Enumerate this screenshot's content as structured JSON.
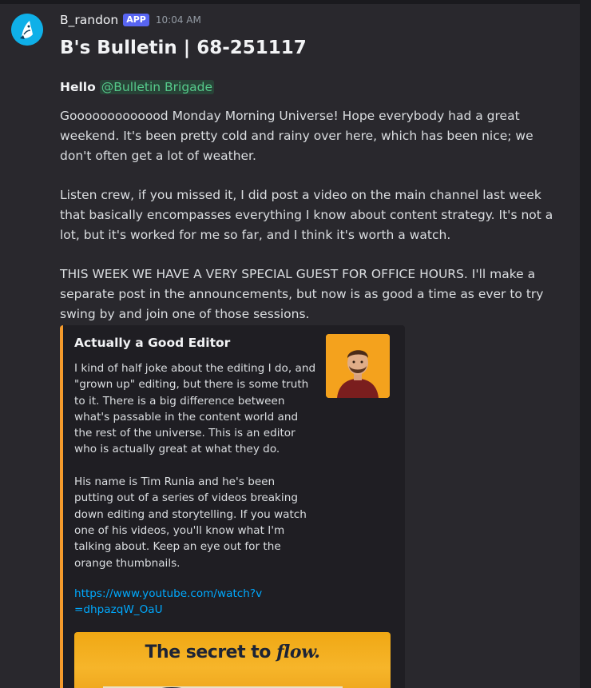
{
  "message": {
    "username": "B_randon",
    "badge": "APP",
    "timestamp": "10:04 AM",
    "avatar_icon": "shark-icon",
    "title": "B's Bulletin | 68-251117",
    "greeting": "Hello",
    "mention": "@Bulletin Brigade",
    "paragraphs": [
      "Gooooooooooood Monday Morning Universe! Hope everybody had a great weekend. It's been pretty cold and rainy over here, which has been nice; we don't often get a lot of weather.",
      "Listen crew, if you missed it, I did post a video on the main channel last week that basically encompasses everything I know about content strategy. It's not a lot, but it's worked for me so far, and I think it's worth a watch.",
      "THIS WEEK WE HAVE A VERY SPECIAL GUEST FOR OFFICE HOURS. I'll make a separate post in the announcements, but now is as good a time as ever to try swing by and join one of those sessions."
    ]
  },
  "embed": {
    "accent_color": "#f49a2c",
    "title": "Actually a Good Editor",
    "description": [
      "I kind of half joke about the editing I do, and \"grown up\" editing, but there is some truth to it. There is a big difference between what's passable in the content world and the rest of the universe. This is an editor who is actually great at what they do.",
      "His name is Tim Runia and he's been putting out of a series of videos breaking down editing and storytelling. If you watch one of his videos, you'll know what I'm talking about. Keep an eye out for the orange thumbnails."
    ],
    "link": "https://www.youtube.com/watch?v=dhpazqW_OaU",
    "image_text_prefix": "The secret to ",
    "image_text_italic": "flow."
  },
  "colors": {
    "background": "#29282d",
    "mention": "#55c98a",
    "link": "#00a8fc",
    "badge": "#5865f2"
  }
}
